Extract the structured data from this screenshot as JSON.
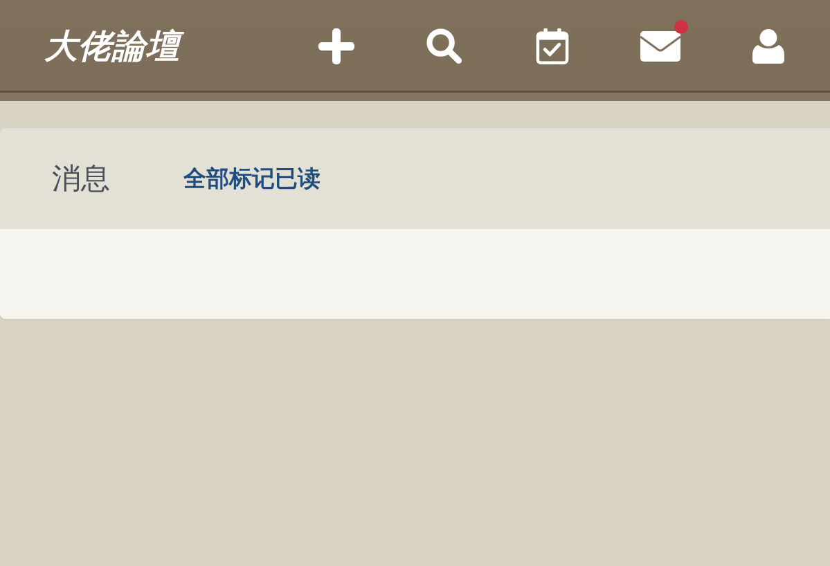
{
  "header": {
    "logo": "大佬論壇",
    "nav": [
      {
        "kind": "add",
        "badge": false
      },
      {
        "kind": "search",
        "badge": false
      },
      {
        "kind": "calendar",
        "badge": false
      },
      {
        "kind": "mail",
        "badge": true
      },
      {
        "kind": "user",
        "badge": false
      }
    ]
  },
  "panel": {
    "title": "消息",
    "action": "全部标记已读"
  }
}
